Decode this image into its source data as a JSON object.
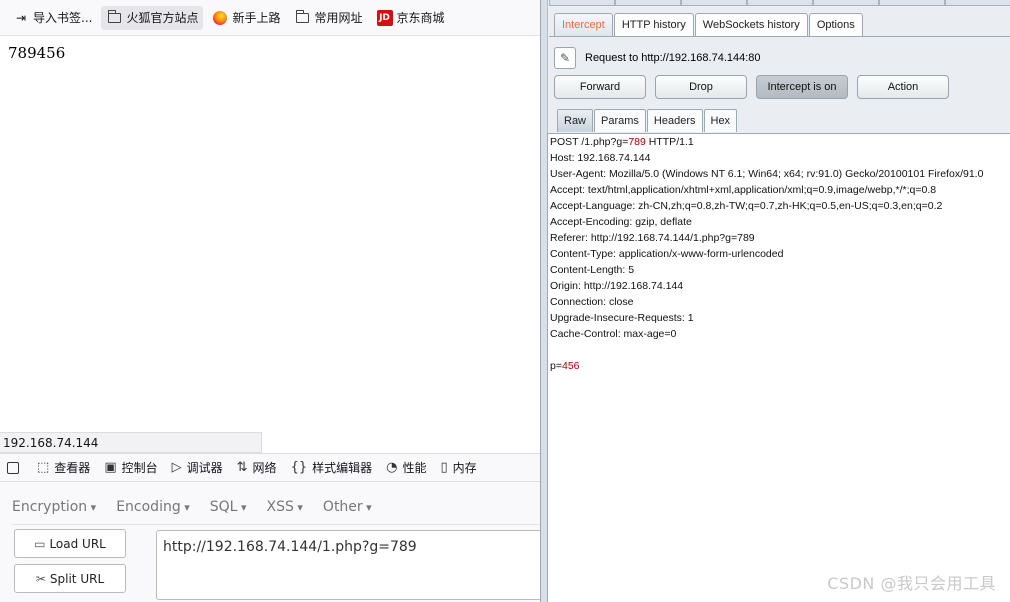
{
  "browser": {
    "bookmarks": [
      {
        "label": "导入书签...",
        "icon": "import-icon"
      },
      {
        "label": "火狐官方站点",
        "icon": "folder-icon",
        "active": true
      },
      {
        "label": "新手上路",
        "icon": "firefox-icon"
      },
      {
        "label": "常用网址",
        "icon": "folder-icon"
      },
      {
        "label": "京东商城",
        "icon": "jd-icon",
        "icon_text": "JD"
      }
    ],
    "page_content": "789456",
    "status_url": "192.168.74.144",
    "devtools_tabs": [
      {
        "label": "查看器",
        "icon": "inspector-icon"
      },
      {
        "label": "控制台",
        "icon": "console-icon"
      },
      {
        "label": "调试器",
        "icon": "debugger-icon"
      },
      {
        "label": "网络",
        "icon": "network-icon"
      },
      {
        "label": "样式编辑器",
        "icon": "style-editor-icon"
      },
      {
        "label": "性能",
        "icon": "performance-icon"
      },
      {
        "label": "内存",
        "icon": "memory-icon"
      }
    ]
  },
  "hackbar": {
    "menus": [
      "Encryption",
      "Encoding",
      "SQL",
      "XSS",
      "Other"
    ],
    "load_url_label": "Load URL",
    "split_url_label": "Split URL",
    "url_value": "http://192.168.74.144/1.php?g=789"
  },
  "burp": {
    "tabs": [
      "Intercept",
      "HTTP history",
      "WebSockets history",
      "Options"
    ],
    "active_tab": "Intercept",
    "request_label": "Request to http://192.168.74.144:80",
    "buttons": {
      "forward": "Forward",
      "drop": "Drop",
      "intercept": "Intercept is on",
      "action": "Action"
    },
    "view_tabs": [
      "Raw",
      "Params",
      "Headers",
      "Hex"
    ],
    "active_view": "Raw",
    "request_line": {
      "prefix": "POST /1.php?g=",
      "param": "789",
      "suffix": " HTTP/1.1"
    },
    "headers": [
      "Host: 192.168.74.144",
      "User-Agent: Mozilla/5.0 (Windows NT 6.1; Win64; x64; rv:91.0) Gecko/20100101 Firefox/91.0",
      "Accept: text/html,application/xhtml+xml,application/xml;q=0.9,image/webp,*/*;q=0.8",
      "Accept-Language: zh-CN,zh;q=0.8,zh-TW;q=0.7,zh-HK;q=0.5,en-US;q=0.3,en;q=0.2",
      "Accept-Encoding: gzip, deflate",
      "Referer: http://192.168.74.144/1.php?g=789",
      "Content-Type: application/x-www-form-urlencoded",
      "Content-Length: 5",
      "Origin: http://192.168.74.144",
      "Connection: close",
      "Upgrade-Insecure-Requests: 1",
      "Cache-Control: max-age=0"
    ],
    "body": {
      "key": "p=",
      "value": "456"
    }
  },
  "watermark": "CSDN @我只会用工具"
}
